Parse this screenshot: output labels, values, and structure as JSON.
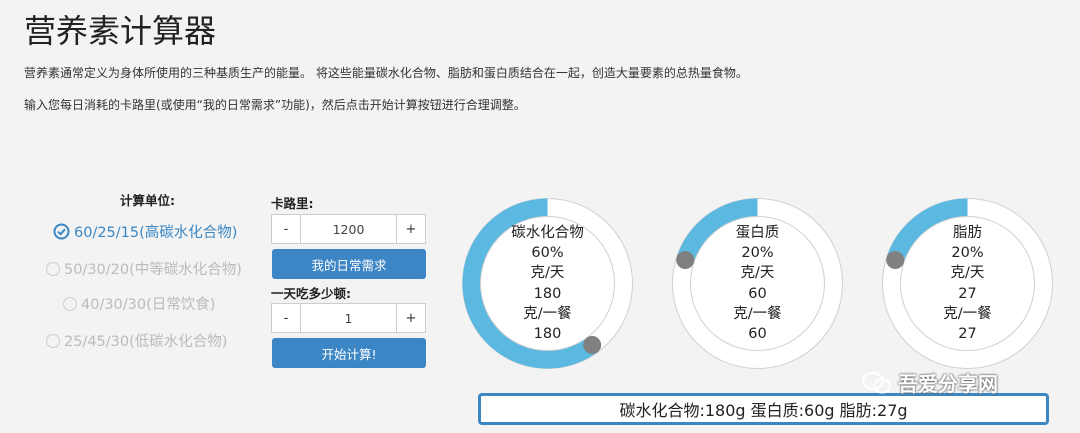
{
  "page": {
    "title": "营养素计算器",
    "desc1": "营养素通常定义为身体所使用的三种基质生产的能量。 将这些能量碳水化合物、脂肪和蛋白质结合在一起，创造大量要素的总热量食物。",
    "desc2": "输入您每日消耗的卡路里(或使用“我的日常需求”功能)，然后点击开始计算按钮进行合理调整。"
  },
  "units": {
    "label": "计算单位:",
    "options": [
      {
        "label": "60/25/15(高碳水化合物)",
        "selected": true
      },
      {
        "label": "50/30/20(中等碳水化合物)",
        "selected": false
      },
      {
        "label": "40/30/30(日常饮食)",
        "selected": false
      },
      {
        "label": "25/45/30(低碳水化合物)",
        "selected": false
      }
    ]
  },
  "calories": {
    "label": "卡路里:",
    "minus": "-",
    "value": "1200",
    "plus": "+"
  },
  "daily_button": "我的日常需求",
  "meals": {
    "label": "一天吃多少顿:",
    "minus": "-",
    "value": "1",
    "plus": "+"
  },
  "start_button": "开始计算!",
  "gauges": [
    {
      "name": "碳水化合物",
      "percent": "60%",
      "fraction": 0.6,
      "unit_day": "克/天",
      "per_day": "180",
      "unit_meal": "克/一餐",
      "per_meal": "180"
    },
    {
      "name": "蛋白质",
      "percent": "20%",
      "fraction": 0.2,
      "unit_day": "克/天",
      "per_day": "60",
      "unit_meal": "克/一餐",
      "per_meal": "60"
    },
    {
      "name": "脂肪",
      "percent": "20%",
      "fraction": 0.2,
      "unit_day": "克/天",
      "per_day": "27",
      "unit_meal": "克/一餐",
      "per_meal": "27"
    }
  ],
  "summary": "碳水化合物:180g 蛋白质:60g 脂肪:27g",
  "watermark": "吾爱分享网",
  "colors": {
    "accent": "#3d86c6",
    "arc": "#5bb8e0",
    "knob": "#808080",
    "selected": "#3a87c4"
  }
}
